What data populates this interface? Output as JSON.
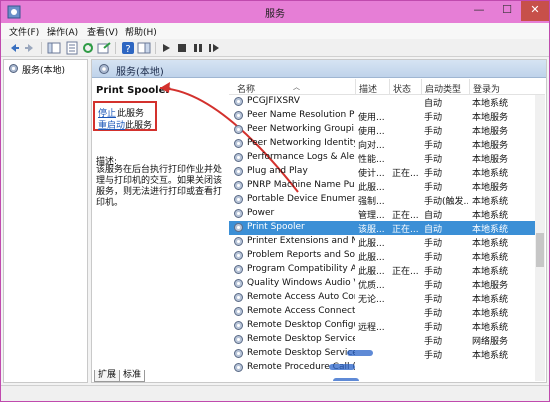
{
  "window": {
    "title": "服务"
  },
  "menu": [
    "文件(F)",
    "操作(A)",
    "查看(V)",
    "帮助(H)"
  ],
  "toolbar": {
    "buttons": [
      "back-icon",
      "forward-icon",
      "show-hide-tree-icon",
      "properties-icon",
      "refresh-icon",
      "export-icon",
      "help-icon",
      "toggle-pane-icon",
      "play-icon",
      "stop-icon",
      "pause-icon",
      "restart-icon"
    ]
  },
  "tree": {
    "root_label": "服务(本地)"
  },
  "pane": {
    "header_label": "服务(本地)"
  },
  "detail": {
    "service_name": "Print Spooler",
    "stop_link": "停止",
    "stop_suffix": "此服务",
    "restart_link": "重启动",
    "restart_suffix": "此服务",
    "desc_label": "描述:",
    "desc_text": "该服务在后台执行打印作业并处理与打印机的交互。如果关闭该服务，则无法进行打印或查看打印机。"
  },
  "columns": {
    "name": "名称",
    "desc": "描述",
    "status": "状态",
    "startup": "启动类型",
    "logon": "登录为"
  },
  "rows": [
    {
      "name": "PCGJFIXSRV",
      "desc": "",
      "status": "",
      "startup": "自动",
      "logon": "本地系统"
    },
    {
      "name": "Peer Name Resolution Pr...",
      "desc": "使用...",
      "status": "",
      "startup": "手动",
      "logon": "本地服务"
    },
    {
      "name": "Peer Networking Groupi...",
      "desc": "使用...",
      "status": "",
      "startup": "手动",
      "logon": "本地服务"
    },
    {
      "name": "Peer Networking Identity...",
      "desc": "向对...",
      "status": "",
      "startup": "手动",
      "logon": "本地服务"
    },
    {
      "name": "Performance Logs & Aler...",
      "desc": "性能...",
      "status": "",
      "startup": "手动",
      "logon": "本地服务"
    },
    {
      "name": "Plug and Play",
      "desc": "使计...",
      "status": "正在...",
      "startup": "手动",
      "logon": "本地系统"
    },
    {
      "name": "PNRP Machine Name Pu...",
      "desc": "此服...",
      "status": "",
      "startup": "手动",
      "logon": "本地服务"
    },
    {
      "name": "Portable Device Enumera...",
      "desc": "强制...",
      "status": "",
      "startup": "手动(触发...",
      "logon": "本地系统"
    },
    {
      "name": "Power",
      "desc": "管理...",
      "status": "正在...",
      "startup": "自动",
      "logon": "本地系统"
    },
    {
      "name": "Print Spooler",
      "desc": "该服...",
      "status": "正在...",
      "startup": "自动",
      "logon": "本地系统"
    },
    {
      "name": "Printer Extensions and N...",
      "desc": "此服...",
      "status": "",
      "startup": "手动",
      "logon": "本地系统"
    },
    {
      "name": "Problem Reports and Sol...",
      "desc": "此服...",
      "status": "",
      "startup": "手动",
      "logon": "本地系统"
    },
    {
      "name": "Program Compatibility A...",
      "desc": "此服...",
      "status": "正在...",
      "startup": "手动",
      "logon": "本地系统"
    },
    {
      "name": "Quality Windows Audio V...",
      "desc": "优质...",
      "status": "",
      "startup": "手动",
      "logon": "本地服务"
    },
    {
      "name": "Remote Access Auto Con...",
      "desc": "无论...",
      "status": "",
      "startup": "手动",
      "logon": "本地系统"
    },
    {
      "name": "Remote Access Connecti...",
      "desc": "",
      "status": "",
      "startup": "手动",
      "logon": "本地系统"
    },
    {
      "name": "Remote Desktop Configu...",
      "desc": "远程...",
      "status": "",
      "startup": "手动",
      "logon": "本地系统"
    },
    {
      "name": "Remote Desktop Services",
      "desc": "",
      "status": "",
      "startup": "手动",
      "logon": "网络服务"
    },
    {
      "name": "Remote Desktop Service...",
      "desc": "",
      "status": "",
      "startup": "手动",
      "logon": "本地系统"
    },
    {
      "name": "Remote Procedure Call (...",
      "desc": "",
      "status": "",
      "startup": "",
      "logon": ""
    }
  ],
  "tabs": [
    "扩展",
    "标准"
  ],
  "colors": {
    "titlebar": "#e67ed6",
    "selection": "#3b8fd6",
    "link": "#1a56b8",
    "highlight_box": "#d3312d"
  }
}
